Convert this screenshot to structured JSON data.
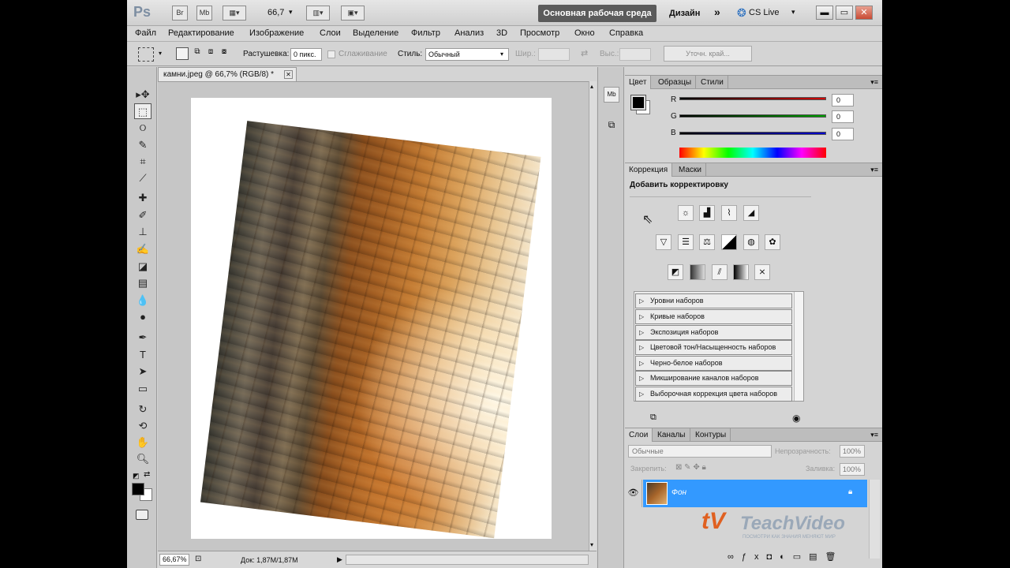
{
  "titlebar": {
    "app_logo": "Ps",
    "br_label": "Br",
    "mb_label": "Mb",
    "zoom_value": "66,7",
    "workspace_button": "Основная рабочая среда",
    "design_label": "Дизайн",
    "cslive_label": "CS Live"
  },
  "menu": [
    "Файл",
    "Редактирование",
    "Изображение",
    "Слои",
    "Выделение",
    "Фильтр",
    "Анализ",
    "3D",
    "Просмотр",
    "Окно",
    "Справка"
  ],
  "options": {
    "feather_label": "Растушевка:",
    "feather_value": "0 пикс.",
    "antialias_label": "Сглаживание",
    "style_label": "Стиль:",
    "style_value": "Обычный",
    "width_label": "Шир.:",
    "height_label": "Выс.:",
    "refine_button": "Уточн. край..."
  },
  "document": {
    "tab_title": "камни.jpeg @ 66,7% (RGB/8) *",
    "status_zoom": "66,67%",
    "status_doc": "Док: 1,87M/1,87M"
  },
  "color_panel": {
    "tabs": [
      "Цвет",
      "Образцы",
      "Стили"
    ],
    "channels": [
      {
        "label": "R",
        "value": "0",
        "color": "#d40000"
      },
      {
        "label": "G",
        "value": "0",
        "color": "#00a000"
      },
      {
        "label": "B",
        "value": "0",
        "color": "#0000d0"
      }
    ]
  },
  "adjustments_panel": {
    "tabs": [
      "Коррекция",
      "Маски"
    ],
    "heading": "Добавить корректировку",
    "presets": [
      "Уровни наборов",
      "Кривые наборов",
      "Экспозиция наборов",
      "Цветовой тон/Насыщенность наборов",
      "Черно-белое наборов",
      "Микширование каналов наборов",
      "Выборочная коррекция цвета наборов"
    ]
  },
  "layers_panel": {
    "tabs": [
      "Слои",
      "Каналы",
      "Контуры"
    ],
    "blend_mode": "Обычные",
    "opacity_label": "Непрозрачность:",
    "opacity_value": "100%",
    "lock_label": "Закрепить:",
    "fill_label": "Заливка:",
    "fill_value": "100%",
    "layer_name": "Фон"
  },
  "watermark": {
    "brand": "TeachVideo",
    "tagline": "ПОСМОТРИ КАК ЗНАНИЯ МЕНЯЮТ МИР"
  }
}
